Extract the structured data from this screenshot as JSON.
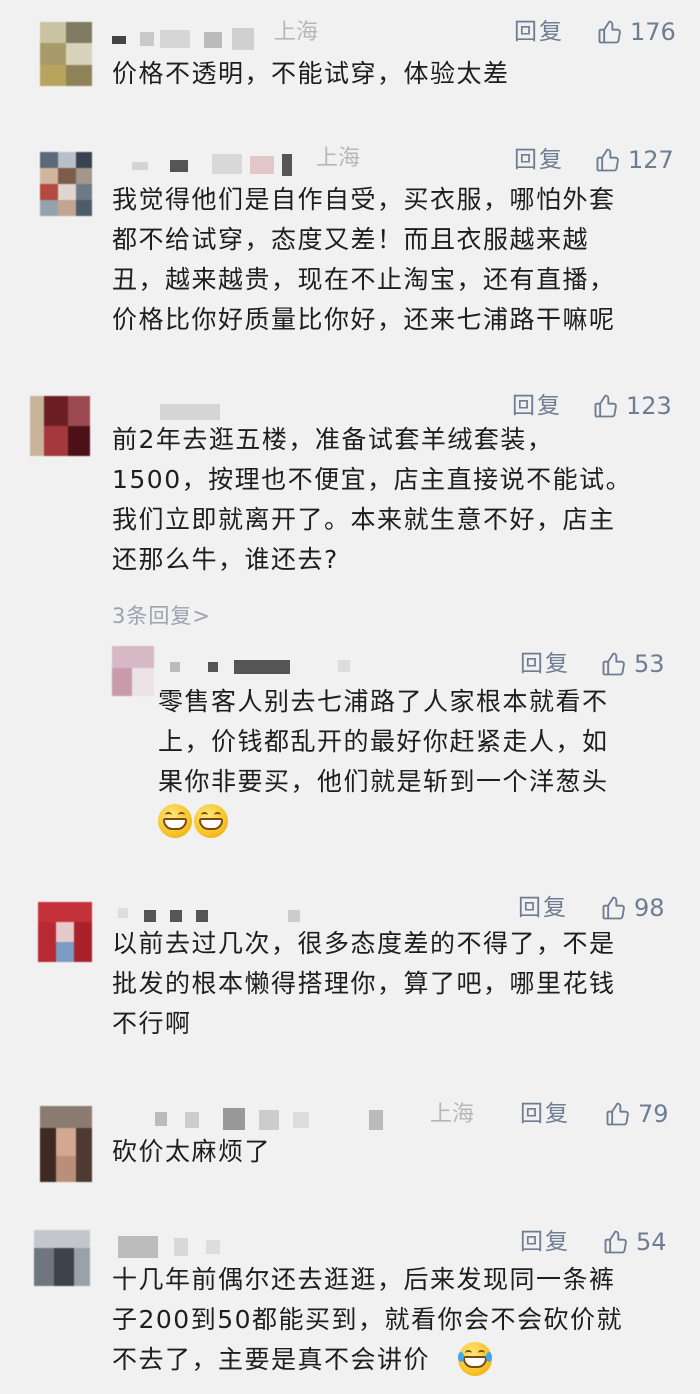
{
  "comments": [
    {
      "location": "上海",
      "reply_label": "回复",
      "likes": "176",
      "text": "价格不透明，不能试穿，体验太差"
    },
    {
      "location": "上海",
      "reply_label": "回复",
      "likes": "127",
      "text": "我觉得他们是自作自受，买衣服，哪怕外套\n都不给试穿，态度又差！而且衣服越来越\n丑，越来越贵，现在不止淘宝，还有直播，\n价格比你好质量比你好，还来七浦路干嘛呢"
    },
    {
      "location": "",
      "reply_label": "回复",
      "likes": "123",
      "text": "前2年去逛五楼，准备试套羊绒套装，\n1500，按理也不便宜，店主直接说不能试。\n我们立即就离开了。本来就生意不好，店主\n还那么牛，谁还去?",
      "more_replies": "3条回复>"
    },
    {
      "location": "",
      "reply_label": "回复",
      "likes": "53",
      "text": "零售客人别去七浦路了人家根本就看不\n上，价钱都乱开的最好你赶紧走人，如\n果你非要买，他们就是斩到一个洋葱头",
      "emoji": "grin-emoji"
    },
    {
      "location": "",
      "reply_label": "回复",
      "likes": "98",
      "text": "以前去过几次，很多态度差的不得了，不是\n批发的根本懒得搭理你，算了吧，哪里花钱\n不行啊"
    },
    {
      "location": "上海",
      "reply_label": "回复",
      "likes": "79",
      "text": "砍价太麻烦了"
    },
    {
      "location": "",
      "reply_label": "回复",
      "likes": "54",
      "text": "十几年前偶尔还去逛逛，后来发现同一条裤\n子200到50都能买到，就看你会不会砍价就\n不去了，主要是真不会讲价",
      "emoji": "laugh-cry-emoji"
    }
  ],
  "colors": {
    "background": "#f1f1f1",
    "text": "#1e1e1e",
    "action": "#6e7d91",
    "location": "#b7b7b7"
  }
}
